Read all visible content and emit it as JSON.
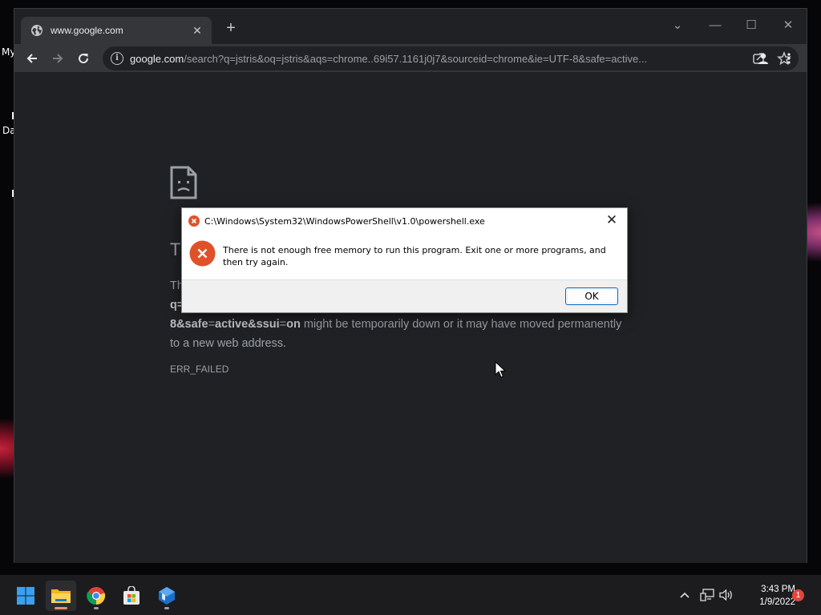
{
  "desktop": {
    "labels": [
      "My",
      "Da"
    ],
    "edge_marks": [
      "I",
      "I"
    ]
  },
  "browser": {
    "tab": {
      "title": "www.google.com",
      "favicon": "globe-icon",
      "close": "✕"
    },
    "new_tab": "+",
    "window_controls": {
      "dropdown": "⌄",
      "minimize": "—",
      "maximize": "☐",
      "close": "✕"
    },
    "toolbar": {
      "back": "arrow-left-icon",
      "forward": "arrow-right-icon",
      "reload": "reload-icon"
    },
    "omnibox": {
      "host": "google.com",
      "path": "/search?q=jstris&oq=jstris&aqs=chrome..69i57.1161j0j7&sourceid=chrome&ie=UTF-8&safe=active..."
    }
  },
  "error_page": {
    "heading": "T",
    "text_line1": "Th",
    "text_line2": "q=",
    "text_line3_bold1": "8&safe",
    "text_line3_eq1": "=",
    "text_line3_bold2": "active&ssui",
    "text_line3_eq2": "=",
    "text_line3_bold3": "on",
    "text_line3_rest": " might be temporarily down or it may have moved permanently",
    "text_line4": "to a new web address.",
    "error_code": "ERR_FAILED"
  },
  "dialog": {
    "title": "C:\\Windows\\System32\\WindowsPowerShell\\v1.0\\powershell.exe",
    "message": "There is not enough free memory to run this program. Exit one or more programs, and then try again.",
    "ok_label": "OK",
    "close": "✕"
  },
  "taskbar": {
    "time": "3:43 PM",
    "date": "1/9/2022",
    "notification_count": "1",
    "overflow": "^"
  },
  "colors": {
    "accent": "#0067c0",
    "error": "#e0512a",
    "notification": "#e2463b"
  }
}
